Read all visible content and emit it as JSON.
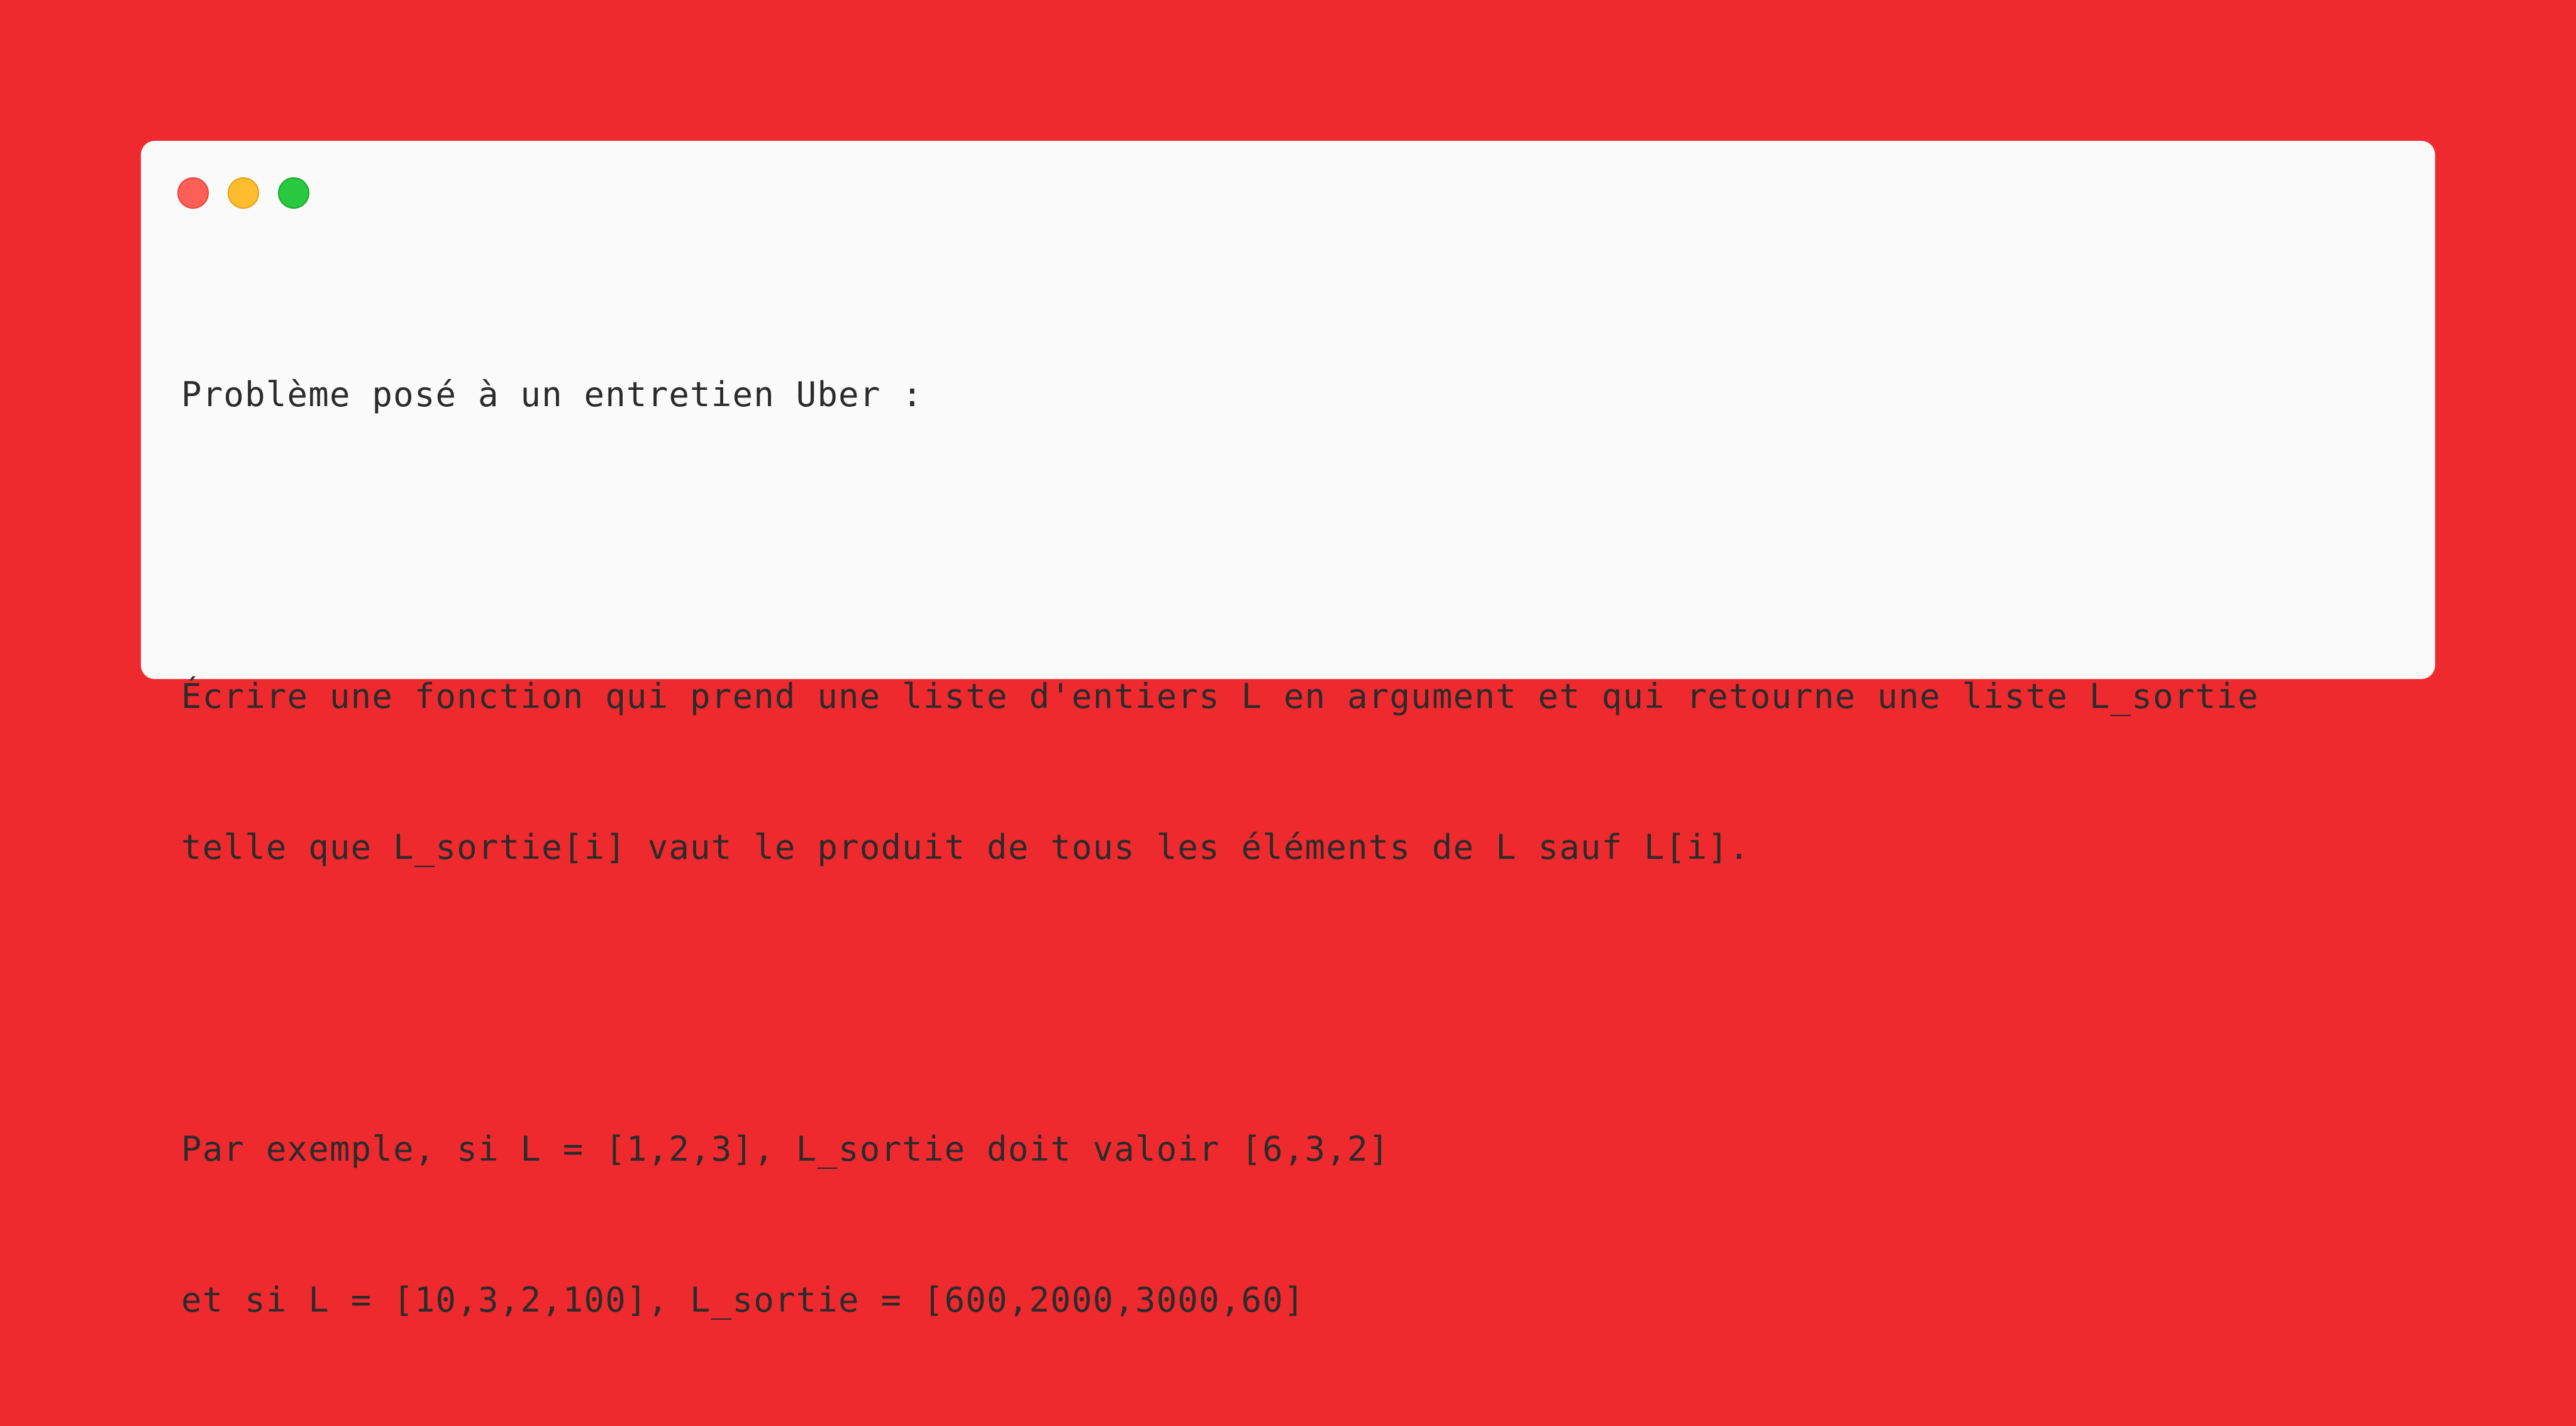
{
  "window": {
    "controls": [
      {
        "name": "close",
        "icon": "red-circle-icon",
        "color": "#ff5f57"
      },
      {
        "name": "minimize",
        "icon": "yellow-circle-icon",
        "color": "#febc2e"
      },
      {
        "name": "zoom",
        "icon": "green-circle-icon",
        "color": "#28c840"
      }
    ],
    "background": "#fafafa"
  },
  "page_background": "#ef2a2f",
  "content": {
    "lines": [
      "Problème posé à un entretien Uber :",
      "",
      "Écrire une fonction qui prend une liste d'entiers L en argument et qui retourne une liste L_sortie",
      "telle que L_sortie[i] vaut le produit de tous les éléments de L sauf L[i].",
      "",
      "Par exemple, si L = [1,2,3], L_sortie doit valoir [6,3,2]",
      "et si L = [10,3,2,100], L_sortie = [600,2000,3000,60]"
    ]
  }
}
